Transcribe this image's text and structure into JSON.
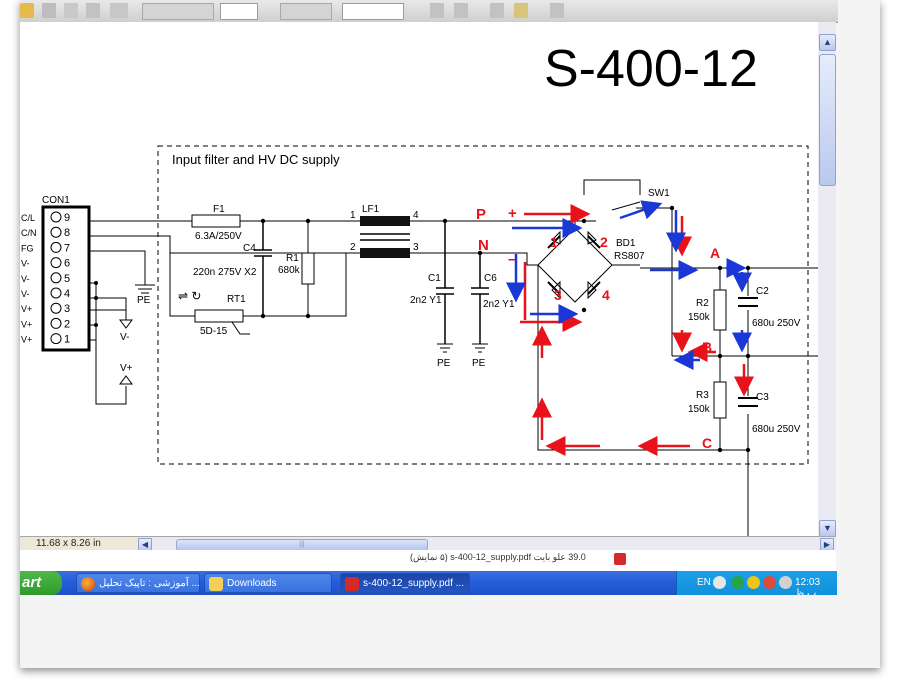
{
  "document": {
    "title": "S-400-12",
    "block_title": "Input filter and HV DC supply"
  },
  "connector": {
    "name": "CON1",
    "pins": [
      "9",
      "8",
      "7",
      "6",
      "5",
      "4",
      "3",
      "2",
      "1"
    ],
    "signals": [
      "AC/L",
      "AC/N",
      "FG",
      "V-",
      "V-",
      "V-",
      "V+",
      "V+",
      "V+"
    ]
  },
  "components": {
    "f1": "F1",
    "f1_val": "6.3A/250V",
    "c4": "C4",
    "c4_val": "220n 275V X2",
    "r1": "R1",
    "r1_val": "680k",
    "rt1": "RT1",
    "rt1_val": "5D-15",
    "lf1": "LF1",
    "lf1_p1": "1",
    "lf1_p2": "2",
    "lf1_p3": "3",
    "lf1_p4": "4",
    "c1": "C1",
    "c1_val": "2n2 Y1",
    "c6": "C6",
    "c6_val": "2n2 Y1",
    "bd1": "BD1",
    "bd1_val": "RS807",
    "sw1": "SW1",
    "r2": "R2",
    "r2_val": "150k",
    "c2": "C2",
    "c2_val": "680u 250V",
    "r3": "R3",
    "r3_val": "150k",
    "c3": "C3",
    "c3_val": "680u 250V",
    "pe": "PE",
    "vminus": "V-",
    "vplus": "V+"
  },
  "annotations": {
    "p": "P",
    "n": "N",
    "plus": "+",
    "minus": "–",
    "d1": "1",
    "d2": "2",
    "d3": "3",
    "d4": "4",
    "a": "A",
    "b": "B",
    "c": "C"
  },
  "statusbar": {
    "page_size": "11.68 x 8.26 in",
    "scroll_grip": "|||"
  },
  "notification": {
    "text": "39.0 علو بایت s-400-12_supply.pdf (۵ نمایش)"
  },
  "taskbar": {
    "start": "art",
    "tasks": [
      {
        "label": "آموزشی : تاپیک تحلیل ..."
      },
      {
        "label": "Downloads"
      },
      {
        "label": "s-400-12_supply.pdf ..."
      }
    ],
    "lang": "EN",
    "clock": "12:03 ب.ظ"
  },
  "colors": {
    "taskbar_blue": "#245edb",
    "annotation_red": "#e8121a",
    "annotation_blue": "#1a38d8"
  }
}
